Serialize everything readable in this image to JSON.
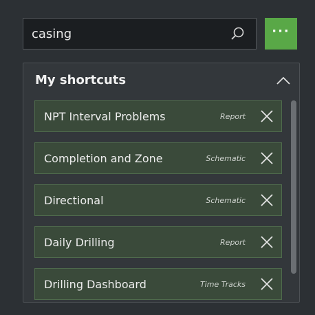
{
  "search": {
    "value": "casing",
    "icon": "search-icon"
  },
  "more_button": {
    "label": "···",
    "color": "#59a847"
  },
  "shortcuts": {
    "title": "My shortcuts",
    "items": [
      {
        "name": "NPT Interval Problems",
        "type": "Report"
      },
      {
        "name": "Completion and Zone",
        "type": "Schematic"
      },
      {
        "name": "Directional",
        "type": "Schematic"
      },
      {
        "name": "Daily Drilling",
        "type": "Report"
      },
      {
        "name": "Drilling Dashboard",
        "type": "Time Tracks"
      }
    ]
  },
  "colors": {
    "background": "#2c3034",
    "item_background": "#3a4a3a",
    "item_border": "#4f6b4c",
    "accent": "#59a847"
  }
}
